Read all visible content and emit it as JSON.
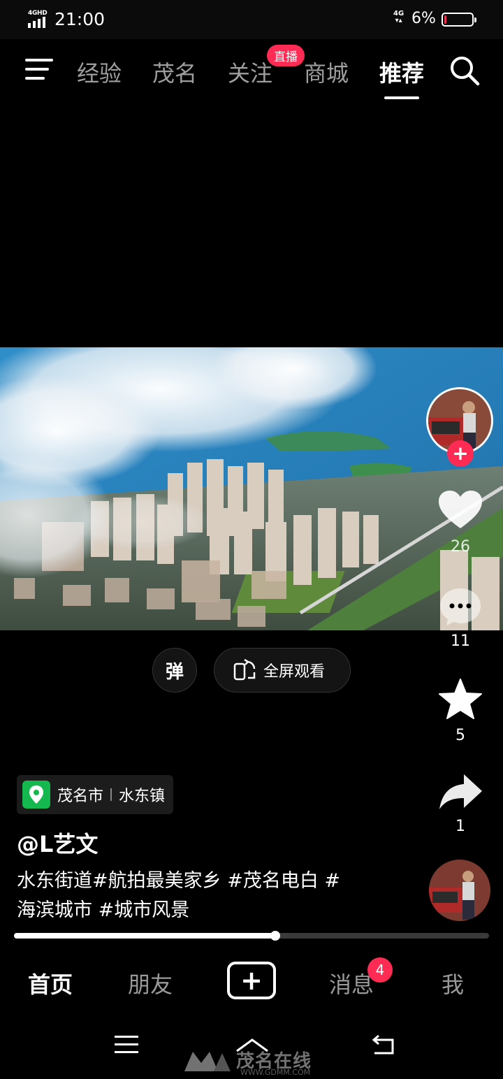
{
  "status_bar": {
    "network_tag": "4GHD",
    "time": "21:00",
    "network_right": "4G",
    "battery_percent": "6%",
    "battery_level": 0.06
  },
  "top_nav": {
    "tabs": [
      {
        "label": "经验"
      },
      {
        "label": "茂名"
      },
      {
        "label": "关注"
      },
      {
        "label": "商城"
      },
      {
        "label": "推荐"
      }
    ],
    "active_tab": "推荐",
    "live_badge": "直播"
  },
  "video": {
    "progress": 0.55
  },
  "actions": {
    "like_count": "26",
    "comment_count": "11",
    "favorite_count": "5",
    "share_count": "1"
  },
  "controls": {
    "danmaku_label": "弹",
    "fullscreen_label": "全屏观看"
  },
  "post": {
    "location_city": "茂名市",
    "location_town": "水东镇",
    "author": "@L艺文",
    "caption_line1": "水东街道#航拍最美家乡 #茂名电白 #",
    "caption_line2": "海滨城市 #城市风景"
  },
  "bottom_nav": {
    "home": "首页",
    "friends": "朋友",
    "messages": "消息",
    "messages_badge": "4",
    "me": "我"
  },
  "watermark": {
    "text": "茂名在线",
    "url": "WWW.GDMM.COM"
  },
  "colors": {
    "accent": "#fe2c55",
    "location_green": "#15b84e",
    "background": "#000000"
  }
}
